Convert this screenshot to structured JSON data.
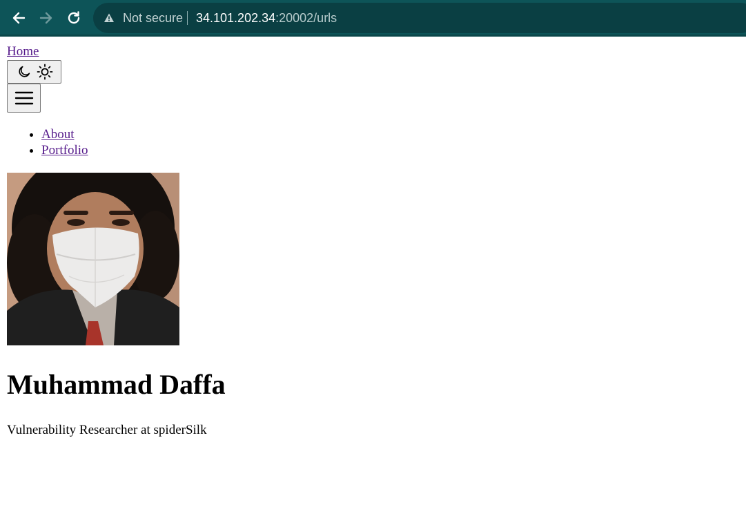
{
  "browser": {
    "security_label": "Not secure",
    "url_host": "34.101.202.34",
    "url_path": ":20002/urls",
    "icons": {
      "back": "arrow-left-icon",
      "forward": "arrow-right-icon",
      "reload": "reload-icon",
      "warning": "warning-triangle-icon"
    },
    "colors": {
      "toolbar": "#0d5458",
      "omnibox": "#0a3f43"
    }
  },
  "header": {
    "home_link": "Home",
    "theme_toggle_icons": [
      "moon-icon",
      "sun-icon"
    ],
    "menu_icon": "hamburger-menu-icon"
  },
  "nav": {
    "items": [
      {
        "label": "About"
      },
      {
        "label": "Portfolio"
      }
    ]
  },
  "profile": {
    "name": "Muhammad Daffa",
    "tagline": "Vulnerability Researcher at spiderSilk"
  }
}
